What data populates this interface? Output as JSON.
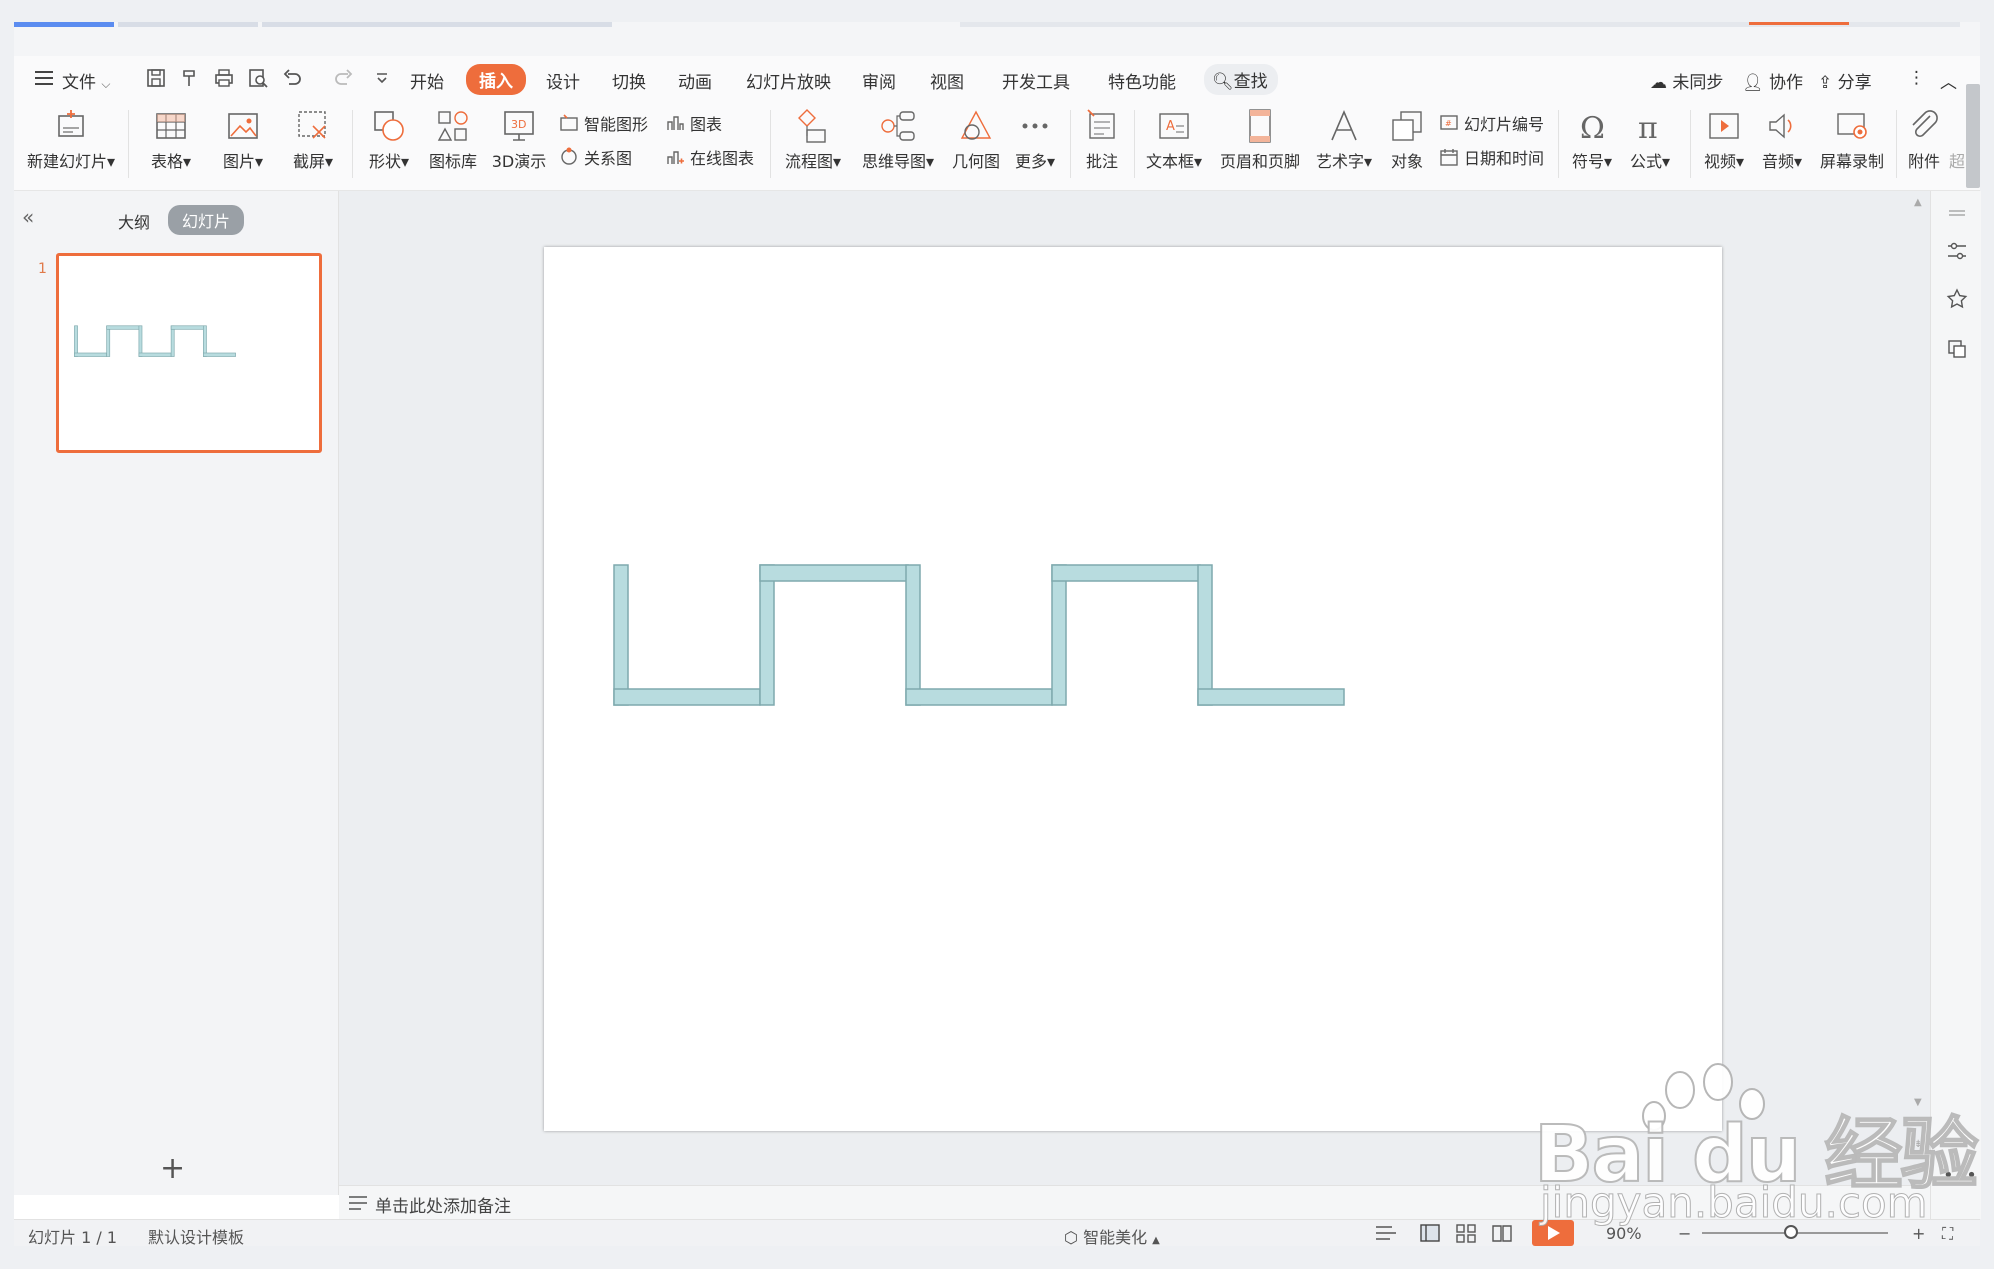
{
  "menu": {
    "file": "文件",
    "tabs": [
      "开始",
      "插入",
      "设计",
      "切换",
      "动画",
      "幻灯片放映",
      "审阅",
      "视图",
      "开发工具",
      "特色功能"
    ],
    "active_tab": "插入",
    "search": "查找",
    "right": {
      "sync": "未同步",
      "collab": "协作",
      "share": "分享"
    }
  },
  "ribbon": {
    "new_slide": "新建幻灯片",
    "table": "表格",
    "picture": "图片",
    "screenshot": "截屏",
    "shape": "形状",
    "icon_lib": "图标库",
    "demo3d": "3D演示",
    "smart_graphic": "智能图形",
    "chart": "图表",
    "relation": "关系图",
    "online_chart": "在线图表",
    "flowchart": "流程图",
    "mindmap": "思维导图",
    "geometry": "几何图",
    "more": "更多",
    "comment": "批注",
    "textbox": "文本框",
    "header_footer": "页眉和页脚",
    "wordart": "艺术字",
    "object": "对象",
    "slide_number": "幻灯片编号",
    "datetime": "日期和时间",
    "symbol": "符号",
    "formula": "公式",
    "video": "视频",
    "audio": "音频",
    "screen_record": "屏幕录制",
    "attachment": "附件",
    "overflow": "超"
  },
  "left_panel": {
    "outline": "大纲",
    "slides": "幻灯片",
    "slide_index": "1",
    "add": "+"
  },
  "notes": {
    "placeholder": "单击此处添加备注"
  },
  "status": {
    "slide_count": "幻灯片 1 / 1",
    "template": "默认设计模板",
    "beautify": "智能美化",
    "zoom": "90%"
  },
  "colors": {
    "accent": "#ee6d3c",
    "shape_fill": "#b8dcdf",
    "shape_stroke": "#7fa9ad"
  },
  "watermark": {
    "brand": "Bai du 经验",
    "url": "jingyan.baidu.com"
  }
}
